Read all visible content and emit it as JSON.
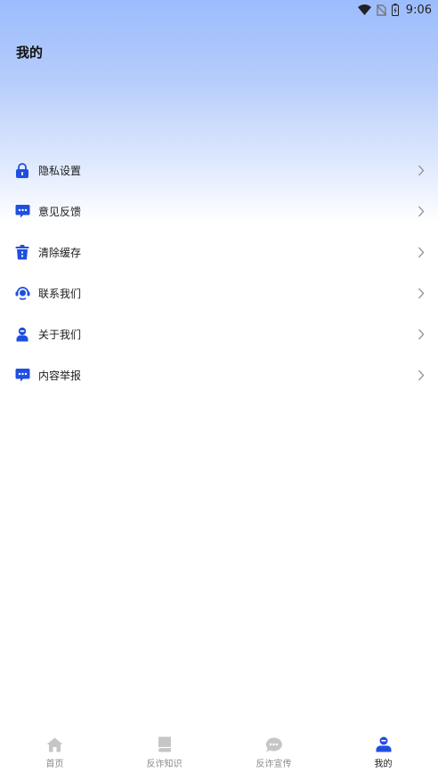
{
  "status_bar": {
    "time": "9:06"
  },
  "header": {
    "title": "我的"
  },
  "menu": {
    "items": [
      {
        "label": "隐私设置",
        "icon": "lock-icon"
      },
      {
        "label": "意见反馈",
        "icon": "chat-bubble-icon"
      },
      {
        "label": "清除缓存",
        "icon": "trash-icon"
      },
      {
        "label": "联系我们",
        "icon": "headset-icon"
      },
      {
        "label": "关于我们",
        "icon": "user-icon"
      },
      {
        "label": "内容举报",
        "icon": "chat-bubble-icon"
      }
    ]
  },
  "bottom_nav": {
    "items": [
      {
        "label": "首页",
        "icon": "home-icon",
        "active": false
      },
      {
        "label": "反诈知识",
        "icon": "book-icon",
        "active": false
      },
      {
        "label": "反诈宣传",
        "icon": "chat-icon",
        "active": false
      },
      {
        "label": "我的",
        "icon": "user-icon",
        "active": true
      }
    ]
  },
  "colors": {
    "accent": "#1f4fe0",
    "inactive": "#c6c6c6",
    "gradient_top": "#9bbcfd"
  }
}
